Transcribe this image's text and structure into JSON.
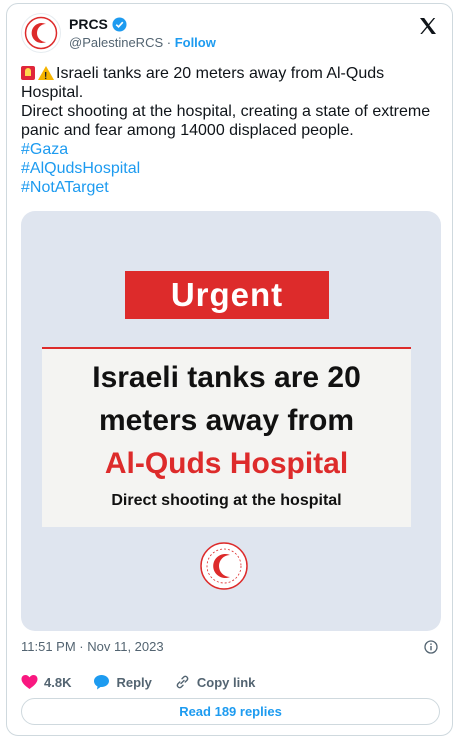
{
  "account": {
    "name": "PRCS",
    "handle": "@PalestineRCS",
    "separator": " · ",
    "follow_label": "Follow"
  },
  "post": {
    "line1": "Israeli tanks are 20 meters away from Al-Quds Hospital.",
    "line2": "Direct shooting at the hospital, creating a state of extreme panic and fear among 14000 displaced people.",
    "hashtags": [
      "#Gaza",
      "#AlQudsHospital",
      "#NotATarget"
    ]
  },
  "media": {
    "badge": "Urgent",
    "headline1": "Israeli tanks are 20",
    "headline2": "meters away from",
    "headline3": "Al-Quds Hospital",
    "subline": "Direct shooting at the hospital"
  },
  "meta": {
    "timestamp": "11:51 PM · Nov 11, 2023"
  },
  "actions": {
    "likes": "4.8K",
    "reply_label": "Reply",
    "copy_label": "Copy link"
  },
  "replies_button": "Read 189 replies",
  "colors": {
    "accent": "#1d9bf0",
    "red": "#dd2b2b",
    "like": "#f91880"
  },
  "icons": [
    "prcs-logo",
    "verified-badge-icon",
    "x-logo-icon",
    "siren-icon",
    "warning-icon",
    "info-icon",
    "heart-icon",
    "reply-icon",
    "link-icon"
  ]
}
